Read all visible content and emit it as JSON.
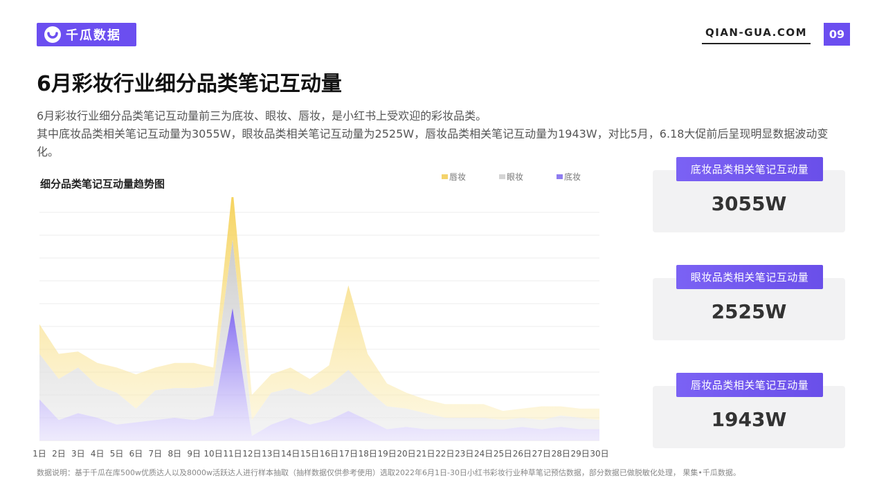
{
  "header": {
    "logo_text": "千瓜数据",
    "site": "QIAN-GUA.COM",
    "page_number": "09"
  },
  "title": "6月彩妆行业细分品类笔记互动量",
  "description": {
    "line1": "6月彩妆行业细分品类笔记互动量前三为底妆、眼妆、唇妆，是小红书上受欢迎的彩妆品类。",
    "line2": "其中底妆品类相关笔记互动量为3055W，眼妆品类相关笔记互动量为2525W，唇妆品类相关笔记互动量为1943W，对比5月，6.18大促前后呈现明显数据波动变化。"
  },
  "cards": [
    {
      "label": "底妆品类相关笔记互动量",
      "value": "3055W"
    },
    {
      "label": "眼妆品类相关笔记互动量",
      "value": "2525W"
    },
    {
      "label": "唇妆品类相关笔记互动量",
      "value": "1943W"
    }
  ],
  "footnote": "数据说明：基于千瓜在库500w优质达人以及8000w活跃达人进行样本抽取（抽样数据仅供参考使用）选取2022年6月1日-30日小红书彩妆行业种草笔记预估数据，部分数据已做脱敏化处理， 果集•千瓜数据。",
  "chart_data": {
    "type": "area",
    "stacked": true,
    "title": "细分品类笔记互动量趋势图",
    "xlabel": "",
    "ylabel": "",
    "ylim": [
      0,
      100
    ],
    "y_axis_labels_shown": false,
    "grid": true,
    "legend_position": "top-right",
    "categories": [
      "1日",
      "2日",
      "3日",
      "4日",
      "5日",
      "6日",
      "7日",
      "8日",
      "9日",
      "10日",
      "11日",
      "12日",
      "13日",
      "14日",
      "15日",
      "16日",
      "17日",
      "18日",
      "19日",
      "20日",
      "21日",
      "22日",
      "23日",
      "24日",
      "25日",
      "26日",
      "27日",
      "28日",
      "29日",
      "30日"
    ],
    "series": [
      {
        "name": "底妆",
        "color": "#8e7cf0",
        "values": [
          18,
          9,
          12,
          10,
          7,
          8,
          9,
          10,
          9,
          11,
          58,
          2,
          7,
          10,
          7,
          9,
          13,
          9,
          5,
          6,
          5,
          5,
          5,
          5,
          5,
          6,
          5,
          6,
          5,
          5
        ]
      },
      {
        "name": "眼妆",
        "color": "#d4d4d4",
        "values": [
          20,
          18,
          20,
          14,
          14,
          6,
          13,
          13,
          14,
          13,
          30,
          7,
          14,
          13,
          13,
          15,
          18,
          13,
          10,
          8,
          7,
          5,
          5,
          5,
          4,
          4,
          4,
          5,
          5,
          4
        ]
      },
      {
        "name": "唇妆",
        "color": "#f4d36b",
        "values": [
          13,
          11,
          7,
          10,
          11,
          15,
          10,
          11,
          11,
          8,
          23,
          11,
          8,
          9,
          7,
          9,
          37,
          16,
          10,
          7,
          6,
          6,
          6,
          6,
          4,
          4,
          6,
          4,
          4,
          5
        ]
      }
    ]
  }
}
